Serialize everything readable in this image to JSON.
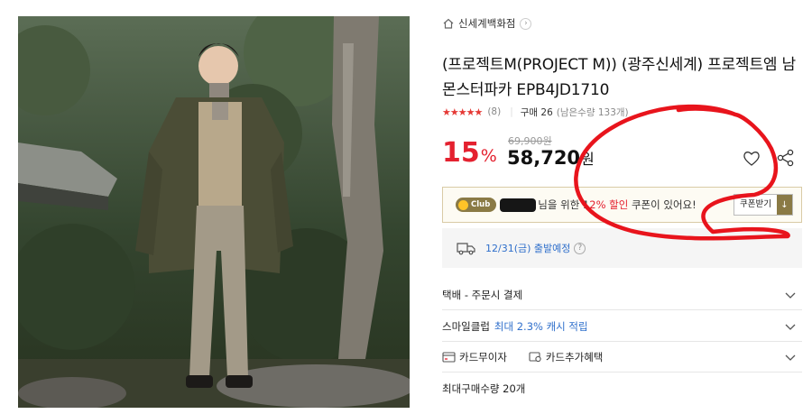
{
  "store": {
    "name": "신세계백화점",
    "home_icon": "home-icon",
    "chevron": "›"
  },
  "product": {
    "title": "(프로젝트M(PROJECT M)) (광주신세계) 프로젝트엠 남 몬스터파카 EPB4JD1710",
    "rating_stars": "★★★★★",
    "rating_value": 4.5,
    "review_count": "(8)",
    "purchase_label": "구매 26",
    "stock_label": "(남은수량 133개)"
  },
  "price": {
    "discount_value": "15",
    "discount_unit": "%",
    "original": "69,900원",
    "sale_value": "58,720",
    "sale_unit": "원"
  },
  "actions": {
    "heart_icon": "heart-icon",
    "share_icon": "share-icon"
  },
  "coupon": {
    "club_label": "Club",
    "text_before": "님을 위한 1",
    "text_hl": "2% 할인",
    "text_after": " 쿠폰이 있어요!",
    "button_label": "쿠폰받기",
    "download_icon": "↓"
  },
  "shipping": {
    "text": "12/31(금) 출발예정",
    "help_icon": "?"
  },
  "rows": {
    "delivery": "택배 - 주문시 결제",
    "smile_label": "스마일클럽",
    "smile_benefit": "최대 2.3% 캐시 적립",
    "card_interest": "카드무이자",
    "card_benefit": "카드추가혜택",
    "max_purchase": "최대구매수량 20개"
  },
  "colors": {
    "accent_red": "#e4212f",
    "link_blue": "#2f6fcb",
    "club_brown": "#8a7a45",
    "annotation_red": "#e8141c"
  }
}
